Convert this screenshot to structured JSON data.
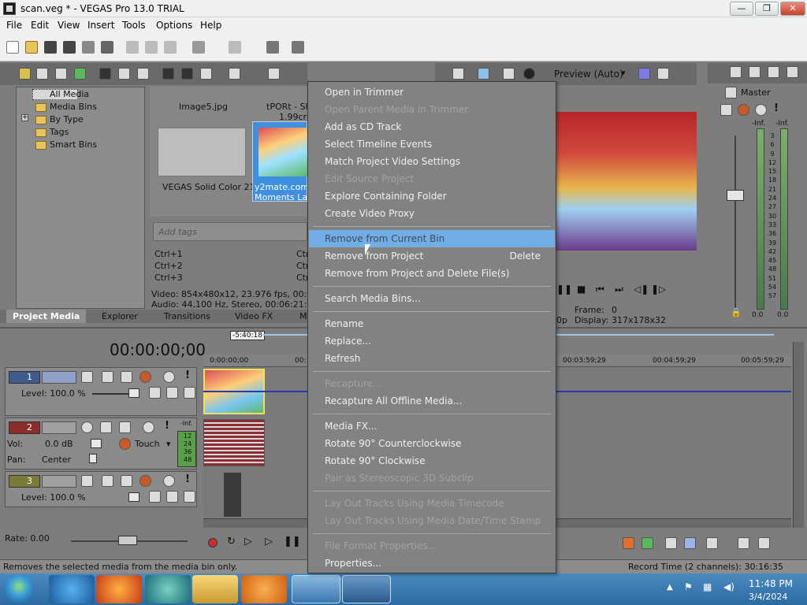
{
  "window": {
    "title": "scan.veg * - VEGAS Pro 13.0 TRIAL",
    "min_glyph": "—",
    "max_glyph": "❐",
    "close_glyph": "✕"
  },
  "menubar": [
    "File",
    "Edit",
    "View",
    "Insert",
    "Tools",
    "Options",
    "Help"
  ],
  "media_tree": [
    "All Media",
    "Media Bins",
    "By Type",
    "Tags",
    "Smart Bins"
  ],
  "media_items": {
    "item1_name": "Image5.jpg",
    "item2_name_line1": "tPORt - Sh",
    "item2_name_line2": "1.99crk",
    "solid_name": "VEGAS Solid Color 21",
    "selected_line1": "y2mate.com -",
    "selected_line2": "Moments Lala"
  },
  "tags_placeholder": "Add tags",
  "shortcuts": [
    "Ctrl+1",
    "Ctrl+2",
    "Ctrl+3"
  ],
  "shortcuts_right": [
    "Ctr",
    "Ctr",
    "Ctr"
  ],
  "info": {
    "video": "Video: 854x480x12, 23.976 fps, 00:06:2",
    "audio": "Audio: 44,100 Hz, Stereo, 00:06:21:22, ."
  },
  "tabs": [
    "Project Media",
    "Explorer",
    "Transitions",
    "Video FX",
    "M"
  ],
  "preview": {
    "mode": "Preview (Auto)",
    "frame_label": "Frame:",
    "frame_value": "0",
    "display_label": "Display:",
    "display_value": "317x178x32",
    "left_fragment": "0p"
  },
  "master": {
    "label": "Master",
    "inf_left": "-Inf.",
    "inf_right": "-Inf.",
    "bottom_left": "0.0",
    "bottom_right": "0.0",
    "scale": [
      "3",
      "6",
      "9",
      "12",
      "15",
      "18",
      "21",
      "24",
      "27",
      "30",
      "33",
      "36",
      "39",
      "42",
      "45",
      "48",
      "51",
      "54",
      "57"
    ]
  },
  "timeline": {
    "timecode": "00:00:00;00",
    "position_marker": "-5:40:18",
    "ruler": [
      "0:00:00;00",
      "00:",
      "00:03:59;29",
      "00:04:59;29",
      "00:05:59;29"
    ]
  },
  "tracks": {
    "t1_num": "1",
    "t1_level": "Level: 100.0 %",
    "t2_num": "2",
    "t2_vol_label": "Vol:",
    "t2_vol_value": "0.0 dB",
    "t2_automation": "Touch",
    "t2_pan_label": "Pan:",
    "t2_pan_value": "Center",
    "t2_meter_inf": "-Inf.",
    "t2_meter": [
      "12",
      "24",
      "36",
      "48"
    ],
    "t3_num": "3",
    "t3_level": "Level: 100.0 %"
  },
  "rate": "Rate: 0.00",
  "status": {
    "message": "Removes the selected media from the media bin only.",
    "record_time": "Record Time (2 channels): 30:16:35"
  },
  "taskbar": {
    "time": "11:48 PM",
    "date": "3/4/2024"
  },
  "context_menu": {
    "items": [
      {
        "label": "Open in Trimmer",
        "enabled": true
      },
      {
        "label": "Open Parent Media in Trimmer",
        "enabled": false
      },
      {
        "label": "Add as CD Track",
        "enabled": true
      },
      {
        "label": "Select Timeline Events",
        "enabled": true
      },
      {
        "label": "Match Project Video Settings",
        "enabled": true
      },
      {
        "label": "Edit Source Project",
        "enabled": false
      },
      {
        "label": "Explore Containing Folder",
        "enabled": true
      },
      {
        "label": "Create Video Proxy",
        "enabled": true
      },
      {
        "label": "Remove from Current Bin",
        "enabled": true,
        "highlighted": true
      },
      {
        "label": "Remove from Project",
        "enabled": true,
        "shortcut": "Delete"
      },
      {
        "label": "Remove from Project and Delete File(s)",
        "enabled": true
      },
      {
        "label": "Search Media Bins...",
        "enabled": true
      },
      {
        "label": "Rename",
        "enabled": true
      },
      {
        "label": "Replace...",
        "enabled": true
      },
      {
        "label": "Refresh",
        "enabled": true
      },
      {
        "label": "Recapture...",
        "enabled": false
      },
      {
        "label": "Recapture All Offline Media...",
        "enabled": true
      },
      {
        "label": "Media FX...",
        "enabled": true
      },
      {
        "label": "Rotate 90° Counterclockwise",
        "enabled": true
      },
      {
        "label": "Rotate 90° Clockwise",
        "enabled": true
      },
      {
        "label": "Pair as Stereoscopic 3D Subclip",
        "enabled": false
      },
      {
        "label": "Lay Out Tracks Using Media Timecode",
        "enabled": false
      },
      {
        "label": "Lay Out Tracks Using Media Date/Time Stamp",
        "enabled": false
      },
      {
        "label": "File Format Properties...",
        "enabled": false
      },
      {
        "label": "Properties...",
        "enabled": true
      }
    ]
  },
  "colors": {
    "highlight": "#72aee6",
    "menu_bg": "#828282",
    "workspace": "#7d7d7d",
    "taskbar": "#2c6aa3"
  }
}
